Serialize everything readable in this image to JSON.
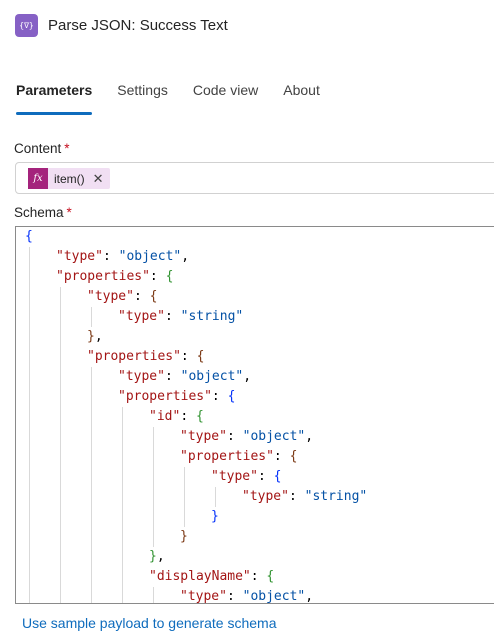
{
  "header": {
    "icon": "curly-braces-icon",
    "icon_glyph": "{∇}",
    "title": "Parse JSON: Success Text",
    "icon_color": "#8661c5"
  },
  "tabs": [
    {
      "label": "Parameters",
      "active": true
    },
    {
      "label": "Settings",
      "active": false
    },
    {
      "label": "Code view",
      "active": false
    },
    {
      "label": "About",
      "active": false
    }
  ],
  "content": {
    "label": "Content",
    "required_mark": "*",
    "token": {
      "icon_glyph": "fx",
      "text": "item()",
      "remove_glyph": "✕"
    }
  },
  "schema": {
    "label": "Schema",
    "required_mark": "*",
    "lines": [
      "{",
      "\"type\": \"object\",",
      "\"properties\": {",
      "\"type\": {",
      "\"type\": \"string\"",
      "},",
      "\"properties\": {",
      "\"type\": \"object\",",
      "\"properties\": {",
      "\"id\": {",
      "\"type\": \"object\",",
      "\"properties\": {",
      "\"type\": {",
      "\"type\": \"string\"",
      "}",
      "}",
      "},",
      "\"displayName\": {",
      "\"type\": \"object\","
    ]
  },
  "footer": {
    "link_label": "Use sample payload to generate schema"
  },
  "colors": {
    "accent": "#0f6cbd",
    "required": "#c50f1f",
    "token_bg": "#f1dff3",
    "fx_bg": "#a4237c"
  }
}
